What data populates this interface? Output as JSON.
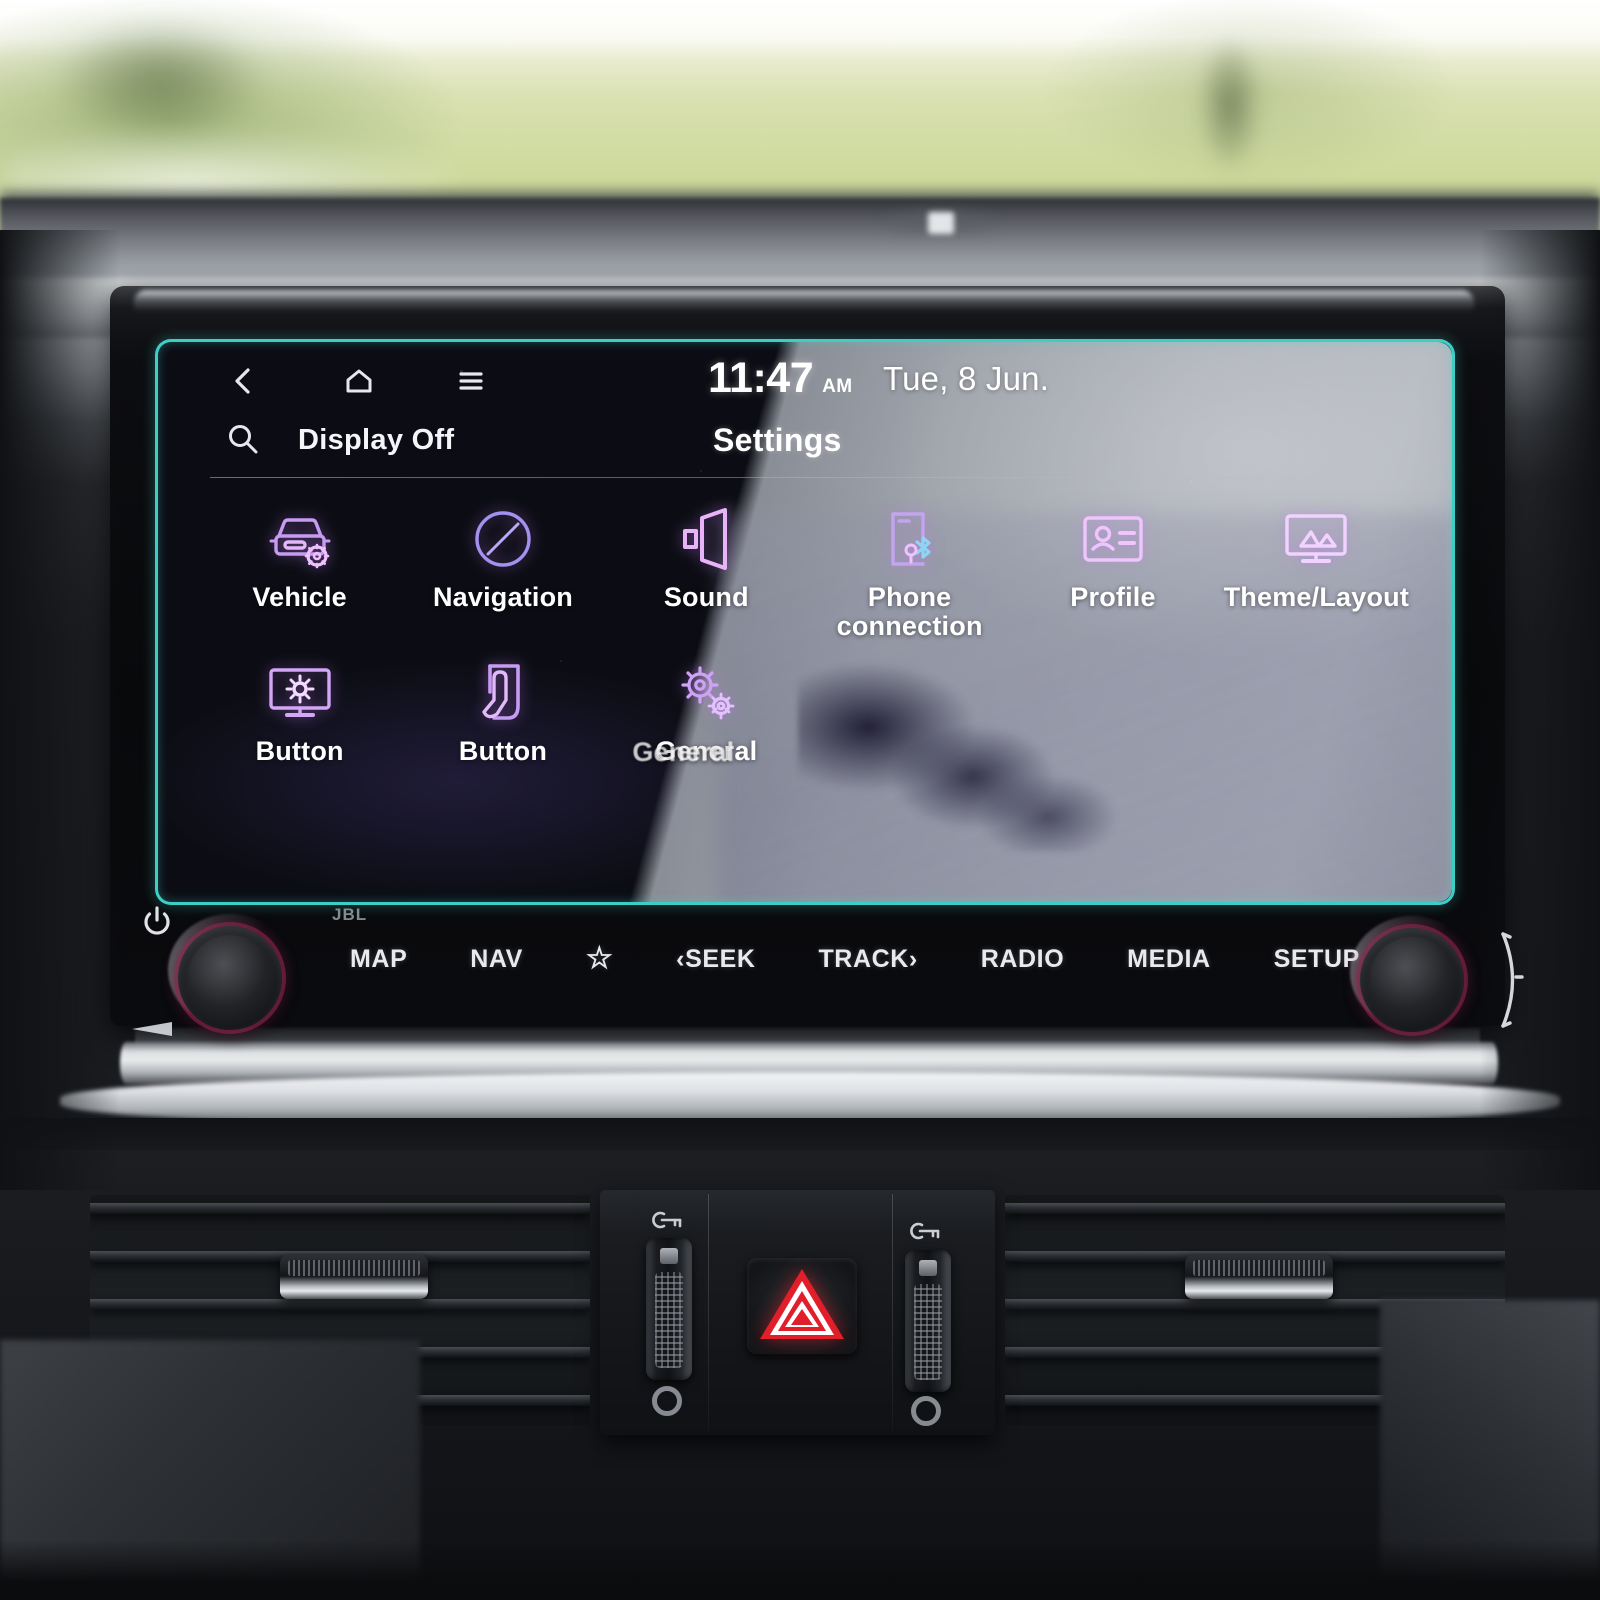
{
  "screen": {
    "statusbar": {
      "back_icon": "chevron-left-icon",
      "home_icon": "home-icon",
      "menu_icon": "hamburger-menu-icon",
      "time": "11:47",
      "ampm": "AM",
      "date": "Tue, 8 Jun."
    },
    "subbar": {
      "search_icon": "search-icon",
      "display_off_label": "Display Off",
      "title": "Settings"
    },
    "tiles": [
      {
        "label": "Vehicle",
        "icon": "car-settings-icon"
      },
      {
        "label": "Navigation",
        "icon": "compass-icon"
      },
      {
        "label": "Sound",
        "icon": "speaker-icon"
      },
      {
        "label": "Phone\nconnection",
        "icon": "phone-bluetooth-icon"
      },
      {
        "label": "Profile",
        "icon": "id-card-icon"
      },
      {
        "label": "Theme/Layout",
        "icon": "monitor-image-icon"
      },
      {
        "label": "Button",
        "icon": "display-brightness-icon"
      },
      {
        "label": "Button",
        "icon": "touch-hand-icon"
      },
      {
        "label": "General",
        "icon": "gears-icon",
        "ghost": "General"
      }
    ]
  },
  "headunit": {
    "brand": "JBL",
    "power_icon": "power-icon",
    "volume_knob_label": "volume-knob",
    "tune_knob_label": "tune-knob",
    "buttons": [
      {
        "label": "MAP"
      },
      {
        "label": "NAV"
      },
      {
        "label": "☆",
        "icon": "star-icon"
      },
      {
        "label": "‹SEEK"
      },
      {
        "label": "TRACK›"
      },
      {
        "label": "RADIO"
      },
      {
        "label": "MEDIA"
      },
      {
        "label": "SETUP"
      }
    ]
  },
  "console": {
    "hazard_icon": "hazard-triangle-icon",
    "vent_left": "air-vent-left",
    "vent_right": "air-vent-right"
  },
  "colors": {
    "protector_teal": "#40d6ce",
    "icon_purple": "#b784f0",
    "icon_pink": "#e7b6f5",
    "hazard_red": "#e01f2b",
    "knob_ring": "#9b2850",
    "screen_bg": "#0c0d14"
  }
}
